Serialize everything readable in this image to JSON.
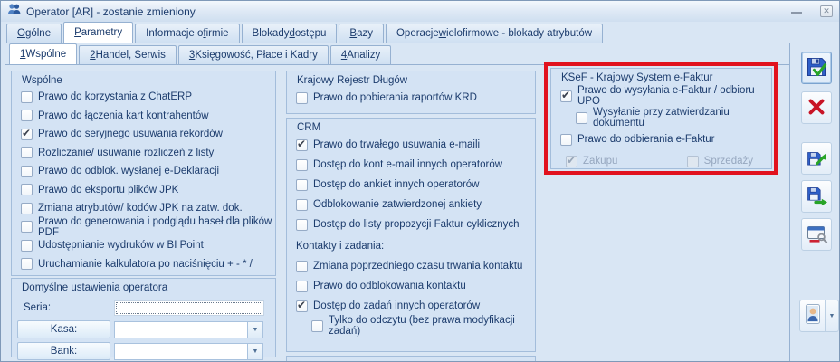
{
  "window": {
    "title": "Operator [AR] - zostanie zmieniony"
  },
  "icons": {
    "minimize": "",
    "close": "✕",
    "dropdown": "▼",
    "operator": "two-people-icon"
  },
  "colors": {
    "window_bg": "#d9e6f4",
    "group_bg": "#d4e3f4",
    "group_border": "#a3bddb",
    "text_navy": "#1c3c6d",
    "titlebar_text": "#1c3c6d",
    "disabled_text": "#96a7bf",
    "highlight_red": "#e1121e",
    "tab_active_bg": "#ffffff"
  },
  "tabs": [
    {
      "id": "ogolne",
      "pre": "",
      "key": "O",
      "post": "gólne",
      "active": false
    },
    {
      "id": "parametry",
      "pre": "",
      "key": "P",
      "post": "arametry",
      "active": true
    },
    {
      "id": "informacje-o-firmie",
      "pre": "Informacje o ",
      "key": "f",
      "post": "irmie",
      "active": false
    },
    {
      "id": "blokady-dostepu",
      "pre": "Blokady ",
      "key": "d",
      "post": "ostępu",
      "active": false
    },
    {
      "id": "bazy",
      "pre": "",
      "key": "B",
      "post": "azy",
      "active": false
    },
    {
      "id": "operacje-wielofirmowe",
      "pre": "Operacje ",
      "key": "w",
      "post": "ielofirmowe - blokady atrybutów",
      "active": false
    }
  ],
  "subtabs": [
    {
      "id": "wspolne",
      "pre": "",
      "key": "1",
      "post": " Wspólne",
      "active": true
    },
    {
      "id": "handel-serwis",
      "pre": "",
      "key": "2",
      "post": " Handel, Serwis",
      "active": false
    },
    {
      "id": "ksiegowosc-place-kadry",
      "pre": "",
      "key": "3",
      "post": " Księgowość, Płace i Kadry",
      "active": false
    },
    {
      "id": "analizy",
      "pre": "",
      "key": "4",
      "post": " Analizy",
      "active": false
    }
  ],
  "groups": {
    "wspolne": {
      "title": "Wspólne",
      "items": [
        {
          "label": "Prawo do korzystania z ChatERP",
          "checked": false
        },
        {
          "label": "Prawo do łączenia kart kontrahentów",
          "checked": false
        },
        {
          "label": "Prawo do seryjnego usuwania rekordów",
          "checked": true
        },
        {
          "label": "Rozliczanie/ usuwanie rozliczeń z listy",
          "checked": false
        },
        {
          "label": "Prawo do odblok. wysłanej e-Deklaracji",
          "checked": false
        },
        {
          "label": "Prawo do eksportu plików JPK",
          "checked": false
        },
        {
          "label": "Zmiana atrybutów/ kodów JPK na zatw. dok.",
          "checked": false
        },
        {
          "label": "Prawo do generowania i podglądu haseł dla plików PDF",
          "checked": false
        },
        {
          "label": "Udostępnianie wydruków w BI Point",
          "checked": false
        },
        {
          "label": "Uruchamianie kalkulatora po naciśnięciu + - * /",
          "checked": false
        }
      ]
    },
    "domyslne": {
      "title": "Domyślne ustawienia operatora",
      "seria_label": "Seria:",
      "seria_value": "",
      "kasa_label": "Kasa:",
      "kasa_value": "",
      "bank_label": "Bank:",
      "bank_value": ""
    },
    "krd": {
      "title": "Krajowy Rejestr Długów",
      "items": [
        {
          "label": "Prawo do pobierania raportów KRD",
          "checked": false
        }
      ]
    },
    "crm": {
      "title": "CRM",
      "items": [
        {
          "label": "Prawo do trwałego usuwania e-maili",
          "checked": true
        },
        {
          "label": "Dostęp do kont e-mail innych operatorów",
          "checked": false
        },
        {
          "label": "Dostęp do ankiet innych operatorów",
          "checked": false
        },
        {
          "label": "Odblokowanie zatwierdzonej ankiety",
          "checked": false
        },
        {
          "label": "Dostęp do listy propozycji Faktur cyklicznych",
          "checked": false
        },
        {
          "label": "Kontakty i zadania:",
          "header": true
        },
        {
          "label": "Zmiana poprzedniego czasu trwania kontaktu",
          "checked": false
        },
        {
          "label": "Prawo do odblokowania kontaktu",
          "checked": false
        },
        {
          "label": "Dostęp do zadań innych operatorów",
          "checked": true
        },
        {
          "label": "Tylko do odczytu (bez prawa modyfikacji zadań)",
          "checked": false,
          "indent": true
        }
      ]
    },
    "ksef": {
      "title": "KSeF - Krajowy System e-Faktur",
      "items": [
        {
          "label": "Prawo do wysyłania e-Faktur / odbioru UPO",
          "checked": true
        },
        {
          "label": "Wysyłanie przy zatwierdzaniu dokumentu",
          "checked": false,
          "indent": true
        },
        {
          "label": "Prawo do odbierania e-Faktur",
          "checked": false
        },
        {
          "label": "Zakupu",
          "checked": true,
          "disabled": true
        },
        {
          "label": "Sprzedaży",
          "checked": false,
          "disabled": true,
          "inline": true
        }
      ]
    }
  },
  "toolbar": {
    "buttons": [
      {
        "name": "save-button",
        "icon": "floppy-check-icon"
      },
      {
        "name": "cancel-button",
        "icon": "red-x-icon"
      },
      {
        "name": "save-variant-1-button",
        "icon": "floppy-arrow-up-icon"
      },
      {
        "name": "save-variant-2-button",
        "icon": "floppy-arrow-right-icon"
      },
      {
        "name": "print-preview-button",
        "icon": "screen-magnifier-icon"
      },
      {
        "name": "operator-card-button",
        "icon": "person-card-icon"
      },
      {
        "name": "operator-card-dropdown",
        "icon": "dropdown-arrow-icon"
      }
    ]
  }
}
